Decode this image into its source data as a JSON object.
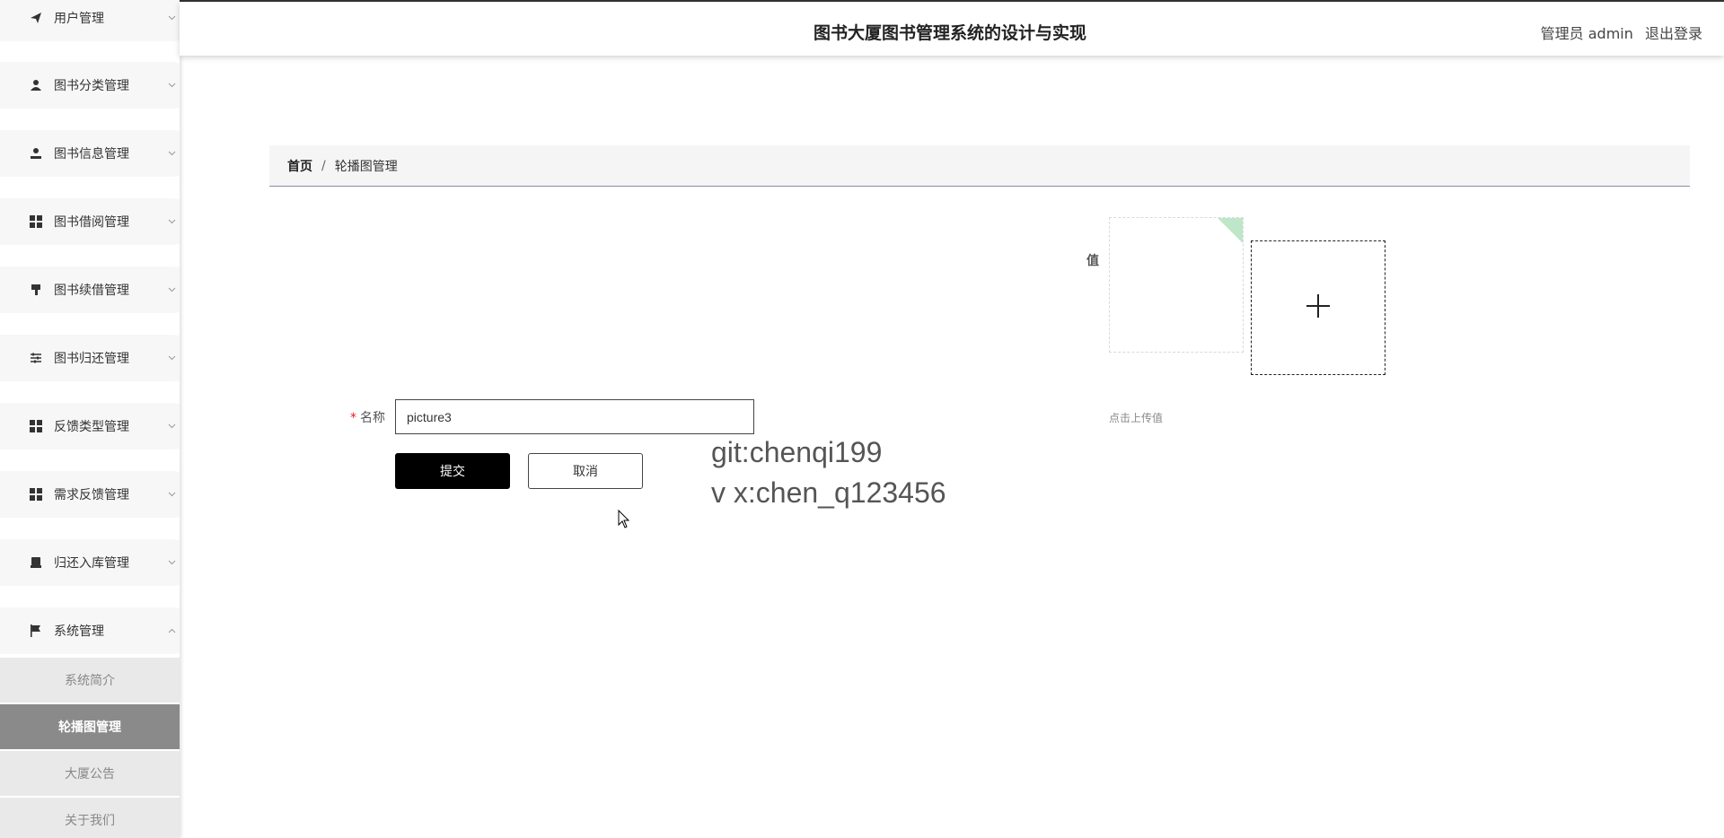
{
  "header": {
    "title": "图书大厦图书管理系统的设计与实现",
    "user": "管理员 admin",
    "logout": "退出登录"
  },
  "sidebar": {
    "items": [
      {
        "label": "用户管理",
        "icon": "paper-plane-icon"
      },
      {
        "label": "图书分类管理",
        "icon": "user-icon"
      },
      {
        "label": "图书信息管理",
        "icon": "user-icon"
      },
      {
        "label": "图书借阅管理",
        "icon": "grid-icon"
      },
      {
        "label": "图书续借管理",
        "icon": "brush-icon"
      },
      {
        "label": "图书归还管理",
        "icon": "sliders-icon"
      },
      {
        "label": "反馈类型管理",
        "icon": "grid-icon"
      },
      {
        "label": "需求反馈管理",
        "icon": "grid-icon"
      },
      {
        "label": "归还入库管理",
        "icon": "inbox-icon"
      },
      {
        "label": "系统管理",
        "icon": "flag-icon"
      }
    ],
    "submenu": [
      {
        "label": "系统简介"
      },
      {
        "label": "轮播图管理"
      },
      {
        "label": "大厦公告"
      },
      {
        "label": "关于我们"
      }
    ]
  },
  "breadcrumb": {
    "home": "首页",
    "separator": "/",
    "current": "轮播图管理"
  },
  "form": {
    "value_label": "值",
    "name_required": "*",
    "name_label": "名称",
    "name_value": "picture3",
    "submit_label": "提交",
    "cancel_label": "取消",
    "upload_tip": "点击上传值"
  },
  "watermark": {
    "line1": "git:chenqi199",
    "line2": "v x:chen_q123456"
  }
}
